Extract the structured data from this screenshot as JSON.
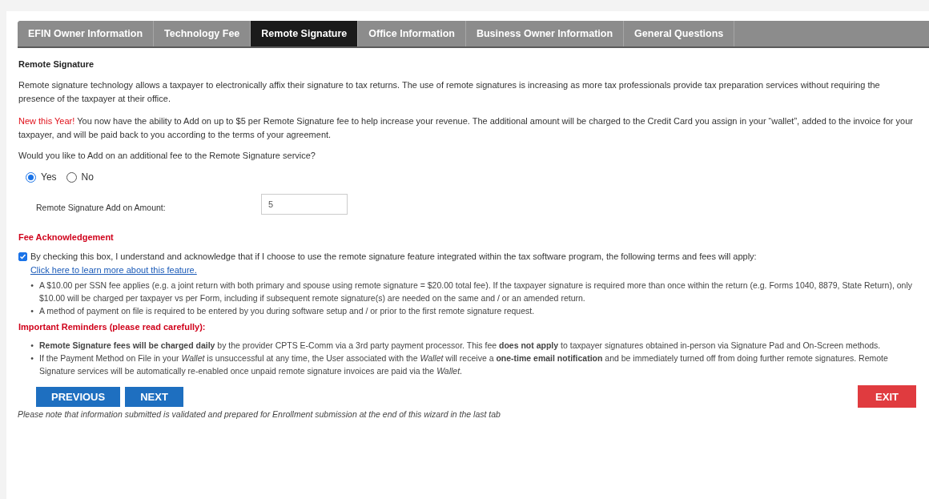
{
  "tabs": [
    {
      "label": "EFIN Owner Information",
      "selected": false
    },
    {
      "label": "Technology Fee",
      "selected": false
    },
    {
      "label": "Remote Signature",
      "selected": true
    },
    {
      "label": "Office Information",
      "selected": false
    },
    {
      "label": "Business Owner Information",
      "selected": false
    },
    {
      "label": "General Questions",
      "selected": false
    }
  ],
  "section_title": "Remote Signature",
  "intro": "Remote signature technology allows a taxpayer to electronically affix their signature to tax returns. The use of remote signatures is increasing as more tax professionals provide tax preparation services without requiring the presence of the taxpayer at their office.",
  "notice": {
    "lead": "New this Year!",
    "text": "You now have the ability to Add on up to $5 per Remote Signature fee to help increase your revenue. The additional amount will be charged to the Credit Card you assign in your “wallet”, added to the invoice for your taxpayer, and will be paid back to you according to the terms of your agreement."
  },
  "question": "Would you like to Add on an additional fee to the Remote Signature service?",
  "options": [
    {
      "label": "Yes",
      "selected": true
    },
    {
      "label": "No",
      "selected": false
    }
  ],
  "amount_field": {
    "label": "Remote Signature Add on Amount:",
    "value": "5"
  },
  "fee_heading": "Fee Acknowledgement",
  "acknowledgement": {
    "checked": true,
    "text": "By checking this box, I understand and acknowledge that if I choose to use the remote signature feature integrated within the tax software program, the following terms and fees will apply:",
    "link": "Click here to learn more about this feature."
  },
  "fee_terms": [
    {
      "bullet": "•",
      "text": "A $10.00 per SSN fee applies (e.g. a joint return with both primary and spouse using remote signature = $20.00 total fee). If the taxpayer signature is required more than once within the return (e.g. Forms 1040, 8879, State Return), only $10.00 will be charged per taxpayer vs per Form, including if subsequent remote signature(s) are needed on the same and / or an amended return."
    },
    {
      "bullet": "•",
      "text": "A method of payment on file is required to be entered by you during software setup and / or prior to the first remote signature request."
    }
  ],
  "reminders_heading": "Important Reminders (please read carefully):",
  "reminders": [
    {
      "bullet": "•",
      "text": "**Remote Signature fees will be charged daily** by the provider CPTS E-Comm via a 3rd party payment processor. This fee **does not apply** to taxpayer signatures obtained in-person via Signature Pad and On-Screen methods."
    },
    {
      "bullet": "•",
      "text": "If the Payment Method on File in your *Wallet* is unsuccessful at any time, the User associated with the *Wallet* will receive a **one-time email notification** and be immediately turned off from doing further remote signatures. Remote Signature services will be automatically re-enabled once unpaid remote signature invoices are paid via the *Wallet*."
    }
  ],
  "buttons": {
    "previous": "PREVIOUS",
    "next": "NEXT",
    "exit": "EXIT"
  },
  "footnote": "Please note that information submitted is validated and prepared for Enrollment submission at the end of this wizard in the last tab"
}
